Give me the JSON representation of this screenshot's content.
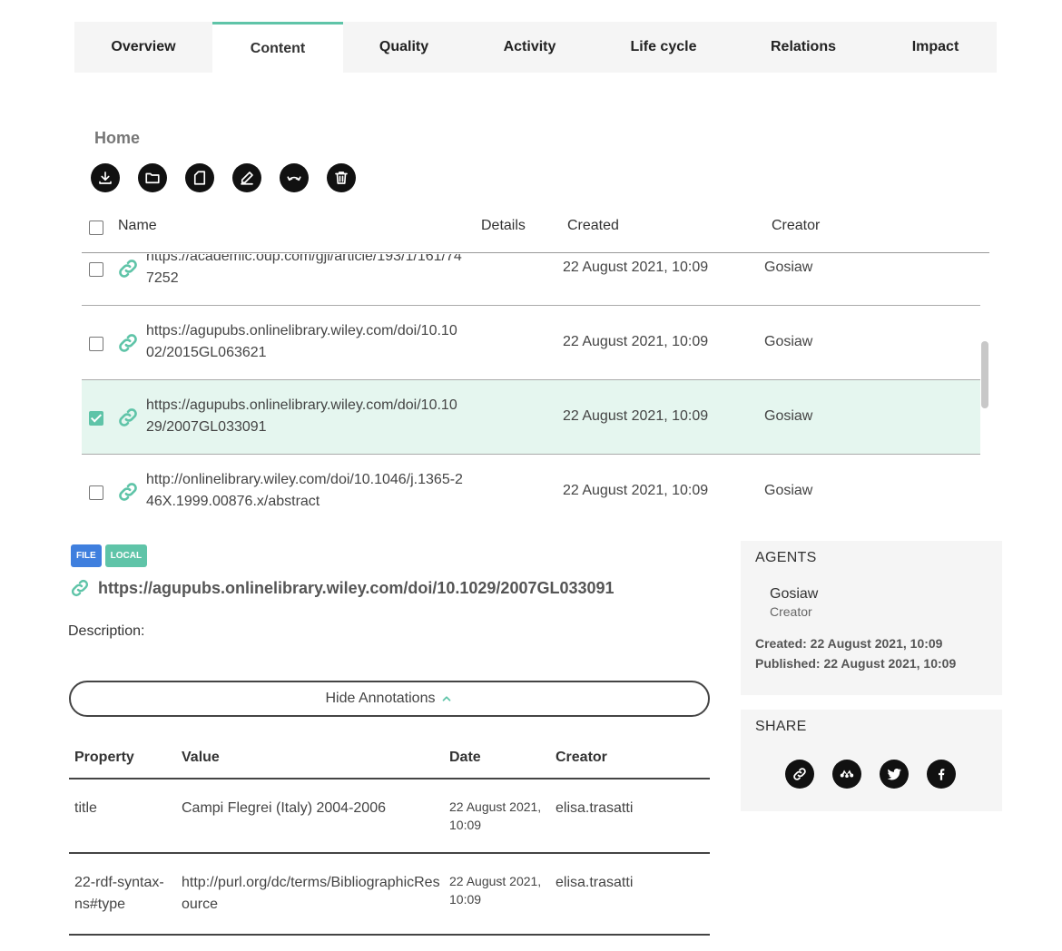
{
  "tabs": [
    {
      "label": "Overview"
    },
    {
      "label": "Content"
    },
    {
      "label": "Quality"
    },
    {
      "label": "Activity"
    },
    {
      "label": "Life cycle"
    },
    {
      "label": "Relations"
    },
    {
      "label": "Impact"
    }
  ],
  "active_tab": "Content",
  "breadcrumb": "Home",
  "toolbar_icons": [
    "download-icon",
    "folder-icon",
    "file-icon",
    "edit-icon",
    "undo-icon",
    "trash-icon"
  ],
  "file_table": {
    "columns": {
      "name": "Name",
      "details": "Details",
      "created": "Created",
      "creator": "Creator"
    },
    "rows": [
      {
        "name": "https://academic.oup.com/gji/article/193/1/161/747252",
        "created": "22 August 2021, 10:09",
        "creator": "Gosiaw",
        "checked": false
      },
      {
        "name": "https://agupubs.onlinelibrary.wiley.com/doi/10.1002/2015GL063621",
        "created": "22 August 2021, 10:09",
        "creator": "Gosiaw",
        "checked": false
      },
      {
        "name": "https://agupubs.onlinelibrary.wiley.com/doi/10.1029/2007GL033091",
        "created": "22 August 2021, 10:09",
        "creator": "Gosiaw",
        "checked": true
      },
      {
        "name": "http://onlinelibrary.wiley.com/doi/10.1046/j.1365-246X.1999.00876.x/abstract",
        "created": "22 August 2021, 10:09",
        "creator": "Gosiaw",
        "checked": false
      }
    ]
  },
  "detail": {
    "badges": {
      "file": "FILE",
      "local": "LOCAL"
    },
    "title": "https://agupubs.onlinelibrary.wiley.com/doi/10.1029/2007GL033091",
    "description_label": "Description:",
    "hide_annotations": "Hide Annotations"
  },
  "annotations": {
    "columns": {
      "property": "Property",
      "value": "Value",
      "date": "Date",
      "creator": "Creator"
    },
    "rows": [
      {
        "property": "title",
        "value": "Campi Flegrei (Italy) 2004-2006",
        "date": "22 August 2021, 10:09",
        "creator": "elisa.trasatti"
      },
      {
        "property": "22-rdf-syntax-ns#type",
        "value": "http://purl.org/dc/terms/BibliographicResource",
        "date": "22 August 2021, 10:09",
        "creator": "elisa.trasatti"
      }
    ]
  },
  "agents": {
    "title": "AGENTS",
    "name": "Gosiaw",
    "role": "Creator",
    "created": "Created: 22 August 2021, 10:09",
    "published": "Published: 22 August 2021, 10:09"
  },
  "share": {
    "title": "SHARE",
    "icons": [
      "link-icon",
      "mendeley-icon",
      "twitter-icon",
      "facebook-icon"
    ]
  },
  "colors": {
    "accent": "#5fc4a8",
    "file_badge": "#3f7fde",
    "selected_row": "#e5f6ef"
  }
}
